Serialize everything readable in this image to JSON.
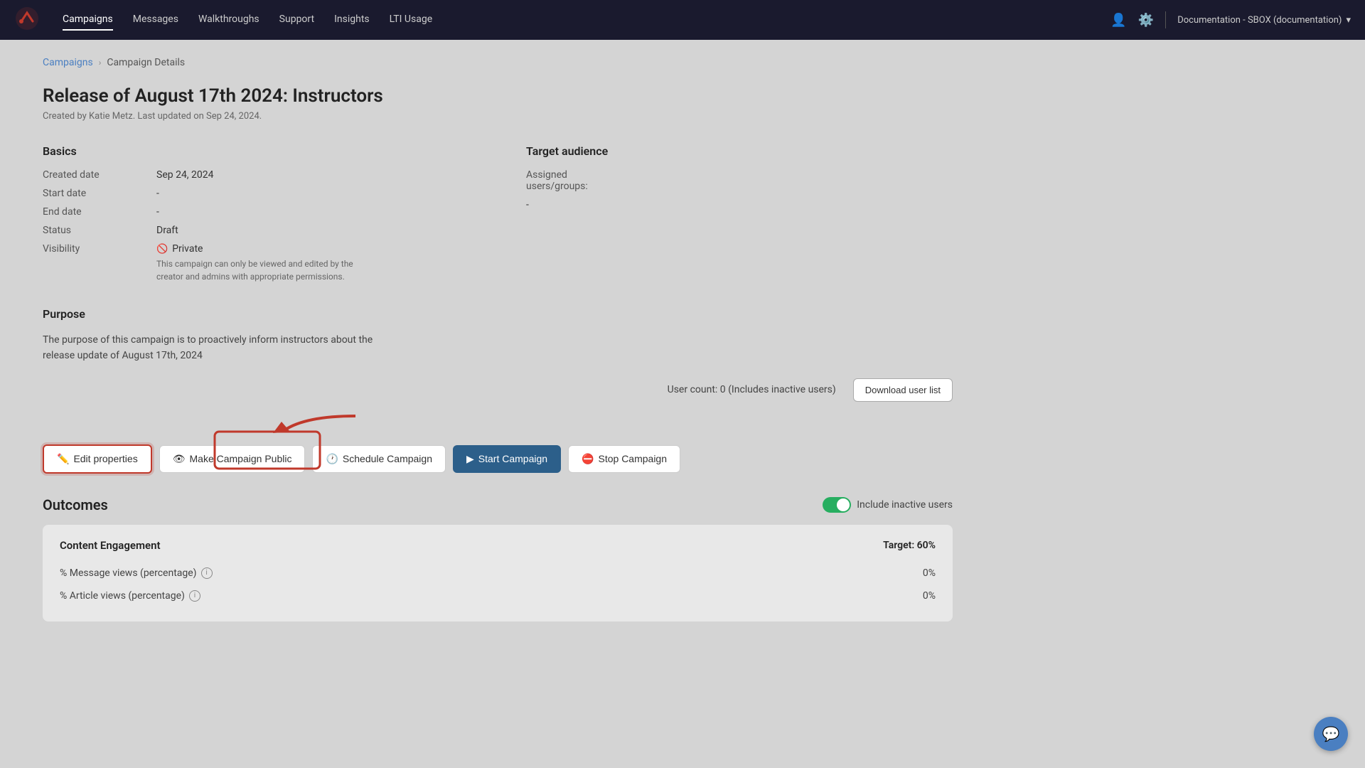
{
  "nav": {
    "logo_alt": "App logo",
    "links": [
      {
        "label": "Campaigns",
        "active": true
      },
      {
        "label": "Messages",
        "active": false
      },
      {
        "label": "Walkthroughs",
        "active": false
      },
      {
        "label": "Support",
        "active": false
      },
      {
        "label": "Insights",
        "active": false
      },
      {
        "label": "LTI Usage",
        "active": false
      }
    ],
    "workspace": "Documentation - SBOX (documentation)"
  },
  "breadcrumb": {
    "parent": "Campaigns",
    "separator": "›",
    "current": "Campaign Details"
  },
  "page": {
    "title": "Release of August 17th 2024: Instructors",
    "subtitle": "Created by Katie Metz. Last updated on Sep 24, 2024."
  },
  "basics": {
    "heading": "Basics",
    "fields": [
      {
        "label": "Created date",
        "value": "Sep 24, 2024"
      },
      {
        "label": "Start date",
        "value": "-"
      },
      {
        "label": "End date",
        "value": "-"
      },
      {
        "label": "Status",
        "value": "Draft"
      },
      {
        "label": "Visibility",
        "value": "Private"
      }
    ],
    "visibility_note": "This campaign can only be viewed and edited by the creator and admins with appropriate permissions."
  },
  "target_audience": {
    "heading": "Target audience",
    "assigned_label": "Assigned users/groups:",
    "assigned_value": "-"
  },
  "purpose": {
    "heading": "Purpose",
    "text": "The purpose of this campaign is to proactively inform instructors about the release update of August 17th, 2024"
  },
  "user_count": {
    "text": "User count: 0 (Includes inactive users)",
    "download_btn": "Download user list"
  },
  "action_buttons": {
    "edit": "Edit properties",
    "make_public": "Make Campaign Public",
    "schedule": "Schedule Campaign",
    "start": "Start Campaign",
    "stop": "Stop Campaign"
  },
  "outcomes": {
    "title": "Outcomes",
    "include_inactive": "Include inactive users",
    "content_engagement": {
      "title": "Content Engagement",
      "target_label": "Target: 60%",
      "rows": [
        {
          "label": "% Message views (percentage)",
          "value": "0%",
          "has_info": true
        },
        {
          "label": "% Article views (percentage)",
          "value": "0%",
          "has_info": true
        }
      ]
    }
  }
}
